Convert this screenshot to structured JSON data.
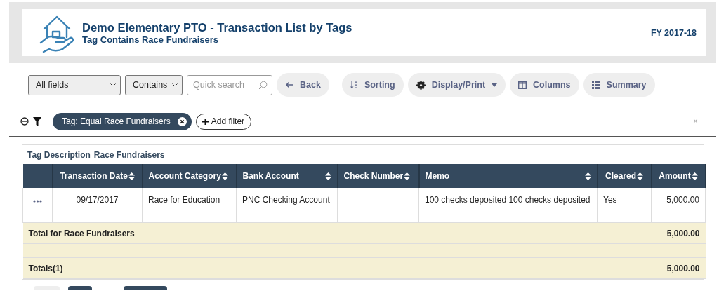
{
  "header": {
    "title": "Demo Elementary PTO - Transaction List by Tags",
    "subtitle": "Tag Contains Race Fundraisers",
    "fiscal_year": "FY 2017-18"
  },
  "toolbar": {
    "field_select": "All fields",
    "operator_select": "Contains",
    "search": {
      "placeholder": "Quick search"
    },
    "buttons": [
      {
        "label": "Back",
        "kind": "back"
      },
      {
        "label": "Sorting",
        "kind": "sort"
      },
      {
        "label": "Display/Print",
        "kind": "display"
      },
      {
        "label": "Columns",
        "kind": "columns"
      },
      {
        "label": "Summary",
        "kind": "summary"
      }
    ]
  },
  "filters": {
    "chips": [
      {
        "label": "Tag: Equal Race Fundraisers"
      }
    ],
    "add_label": "Add filter",
    "clear_symbol": "×"
  },
  "table": {
    "caption_label": "Tag Description",
    "caption_value": "Race Fundraisers",
    "columns": [
      {
        "label": "Transaction Date"
      },
      {
        "label": "Account Category"
      },
      {
        "label": "Bank Account"
      },
      {
        "label": "Check Number"
      },
      {
        "label": "Memo"
      },
      {
        "label": "Cleared"
      },
      {
        "label": "Amount"
      }
    ],
    "rows": [
      {
        "cells": [
          "09/17/2017",
          "Race for Education",
          "PNC Checking Account",
          null,
          "100 checks deposited 100 checks deposited",
          "Yes",
          "5,000.00"
        ]
      }
    ],
    "group_total": {
      "label": "Total for Race Fundraisers",
      "amount": "5,000.00"
    },
    "grand_total": {
      "label": "Totals(1)",
      "amount": "5,000.00"
    }
  }
}
